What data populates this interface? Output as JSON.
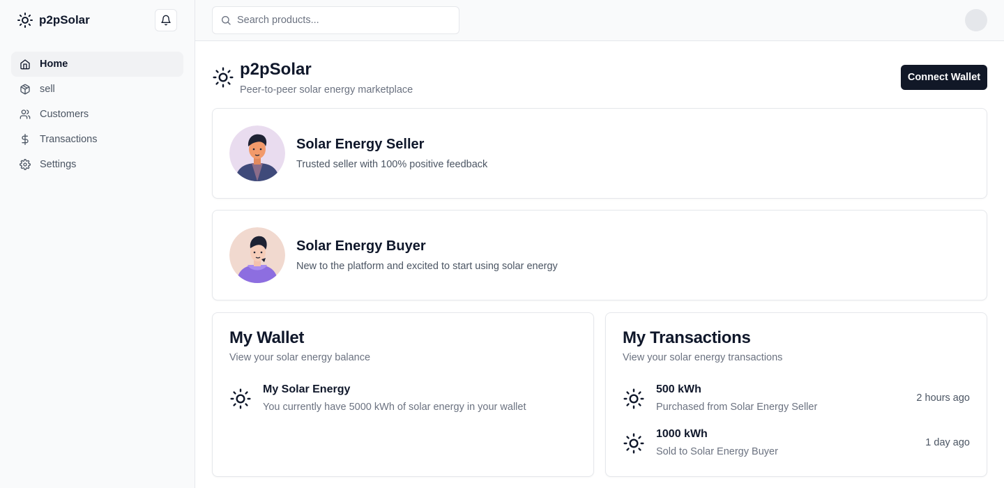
{
  "sidebar": {
    "brand": "p2pSolar",
    "items": [
      {
        "label": "Home",
        "icon": "home-icon",
        "active": true
      },
      {
        "label": "sell",
        "icon": "package-icon",
        "active": false
      },
      {
        "label": "Customers",
        "icon": "users-icon",
        "active": false
      },
      {
        "label": "Transactions",
        "icon": "dollar-icon",
        "active": false
      },
      {
        "label": "Settings",
        "icon": "gear-icon",
        "active": false
      }
    ]
  },
  "topbar": {
    "search_placeholder": "Search products..."
  },
  "header": {
    "title": "p2pSolar",
    "subtitle": "Peer-to-peer solar energy marketplace",
    "connect_label": "Connect Wallet"
  },
  "profiles": [
    {
      "name": "Solar Energy Seller",
      "desc": "Trusted seller with 100% positive feedback"
    },
    {
      "name": "Solar Energy Buyer",
      "desc": "New to the platform and excited to start using solar energy"
    }
  ],
  "wallet": {
    "title": "My Wallet",
    "subtitle": "View your solar energy balance",
    "item_title": "My Solar Energy",
    "item_desc": "You currently have 5000 kWh of solar energy in your wallet"
  },
  "transactions": {
    "title": "My Transactions",
    "subtitle": "View your solar energy transactions",
    "items": [
      {
        "amount": "500 kWh",
        "desc": "Purchased from Solar Energy Seller",
        "time": "2 hours ago"
      },
      {
        "amount": "1000 kWh",
        "desc": "Sold to Solar Energy Buyer",
        "time": "1 day ago"
      }
    ]
  },
  "colors": {
    "primary": "#111827",
    "muted_text": "#6b7280",
    "border": "#e5e7eb",
    "sidebar_bg": "#f9fafb"
  }
}
